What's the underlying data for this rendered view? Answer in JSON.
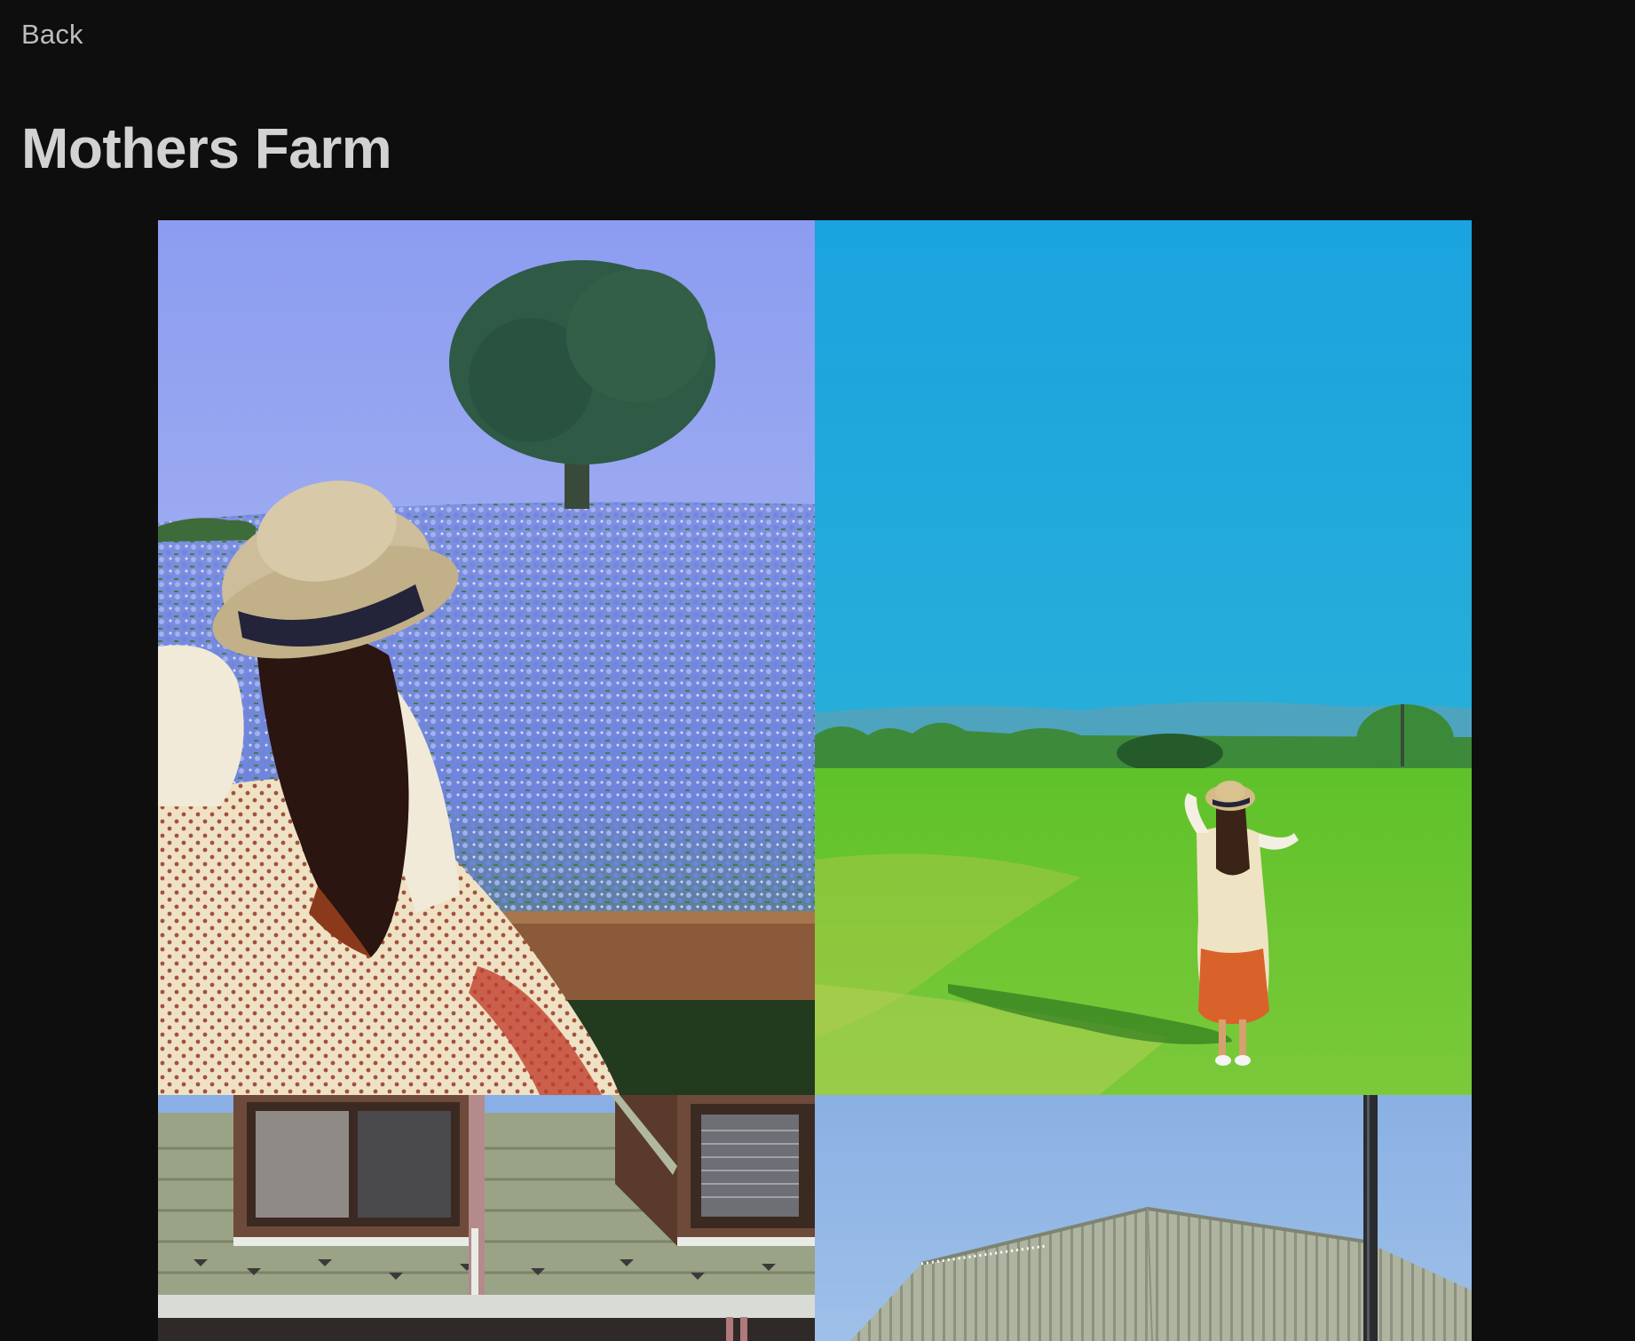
{
  "nav": {
    "back_label": "Back"
  },
  "album": {
    "title": "Mothers Farm",
    "photos": [
      {
        "name": "photo-woman-hat-flower-field"
      },
      {
        "name": "photo-woman-green-field"
      },
      {
        "name": "photo-roof-dormer-windows"
      },
      {
        "name": "photo-barn-roof-sky"
      }
    ]
  },
  "colors": {
    "background": "#0e0e0e",
    "text_primary": "#d2d2d2",
    "text_secondary": "#bdbdbd"
  }
}
